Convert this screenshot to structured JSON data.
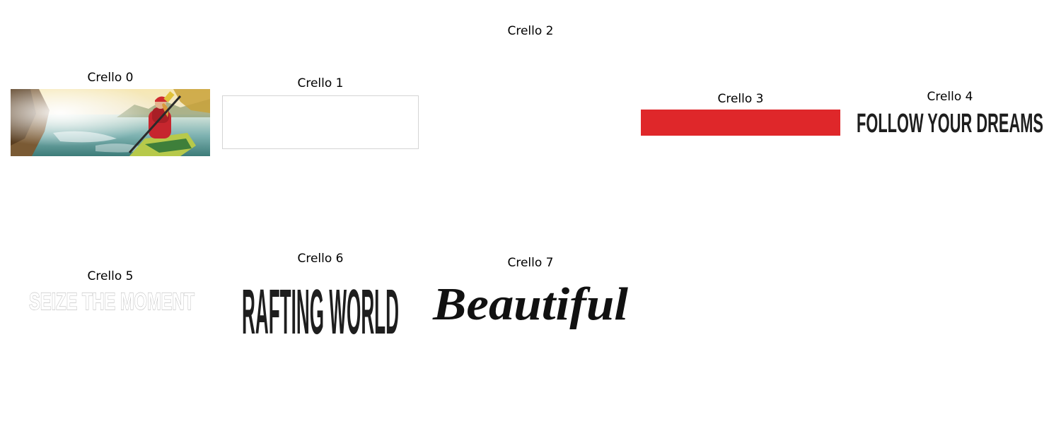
{
  "tiles": [
    {
      "caption": "Crello 0",
      "kind": "photo"
    },
    {
      "caption": "Crello 1",
      "kind": "blank-frame"
    },
    {
      "caption": "Crello 2",
      "kind": "empty"
    },
    {
      "caption": "Crello 3",
      "kind": "color-bar",
      "color": "#df272a"
    },
    {
      "caption": "Crello 4",
      "kind": "headline",
      "text": "FOLLOW YOUR DREAMS",
      "color": "#1e1e1e"
    },
    {
      "caption": "Crello 5",
      "kind": "outline-headline",
      "text": "SEIZE THE MOMENT",
      "color": "#ffffff",
      "stroke": "#b9b9b9"
    },
    {
      "caption": "Crello 6",
      "kind": "headline",
      "text": "RAFTING WORLD",
      "color": "#1e1e1e"
    },
    {
      "caption": "Crello 7",
      "kind": "script",
      "text": "Beautiful",
      "color": "#111111"
    }
  ]
}
